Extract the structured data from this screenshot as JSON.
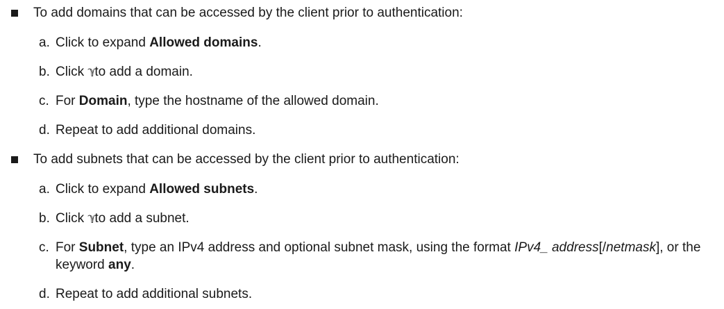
{
  "section1": {
    "intro": "To add domains that can be accessed by the client prior to authentication:",
    "steps": [
      {
        "letter": "a.",
        "pre": "Click to expand ",
        "bold": "Allowed domains",
        "post": "."
      },
      {
        "letter": "b.",
        "pre": "Click ",
        "icon": "add-icon",
        "icon_glyph": "ℽ",
        "post": "to add a domain."
      },
      {
        "letter": "c.",
        "pre": "For ",
        "bold": "Domain",
        "post": ", type the hostname of the allowed domain."
      },
      {
        "letter": "d.",
        "text": "Repeat to add additional domains."
      }
    ]
  },
  "section2": {
    "intro": "To add subnets that can be accessed by the client prior to authentication:",
    "steps": [
      {
        "letter": "a.",
        "pre": "Click to expand ",
        "bold": "Allowed subnets",
        "post": "."
      },
      {
        "letter": "b.",
        "pre": "Click ",
        "icon": "add-icon",
        "icon_glyph": "ℽ",
        "post": "to add a subnet."
      },
      {
        "letter": "c.",
        "pre": "For ",
        "bold": "Subnet",
        "mid": ", type an IPv4 address and optional subnet mask, using the format ",
        "italic1": "IPv4_ address",
        "bracket_open": "[/",
        "italic2": "netmask",
        "bracket_close": "], or the keyword ",
        "bold2": "any",
        "post": "."
      },
      {
        "letter": "d.",
        "text": "Repeat to add additional subnets."
      }
    ]
  }
}
